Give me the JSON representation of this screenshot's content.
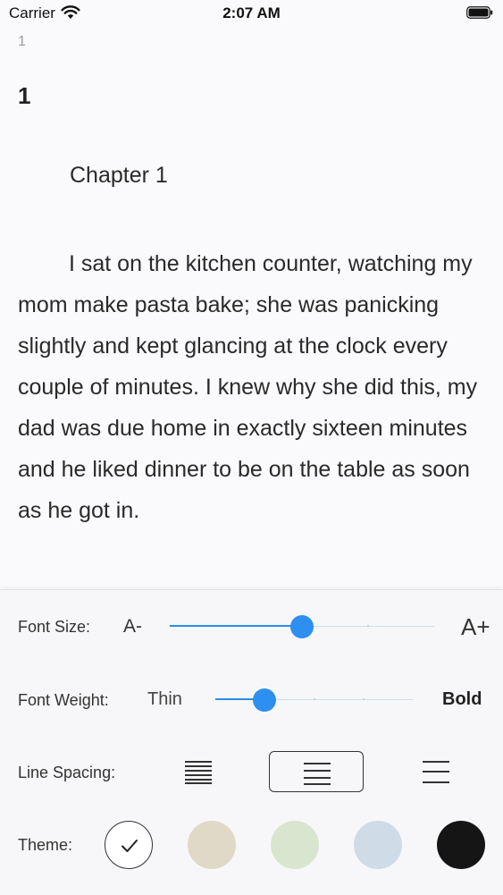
{
  "status_bar": {
    "carrier": "Carrier",
    "time": "2:07 AM"
  },
  "reader": {
    "page_number": "1",
    "chapter_number": "1",
    "chapter_title": "Chapter 1",
    "paragraph": "I sat on the kitchen counter, watching my mom make pasta bake; she was panicking slightly and kept glancing at the clock every couple of minutes. I knew why she did this, my dad was due home in exactly sixteen minutes and he liked dinner to be on the table as soon as he got in."
  },
  "settings": {
    "font_size": {
      "label": "Font Size:",
      "decrease_label": "A-",
      "increase_label": "A+",
      "level": 0.5,
      "steps": 5
    },
    "font_weight": {
      "label": "Font Weight:",
      "min_label": "Thin",
      "max_label": "Bold",
      "level": 0.25,
      "steps": 5
    },
    "line_spacing": {
      "label": "Line Spacing:",
      "options": [
        "compact",
        "normal",
        "wide"
      ],
      "selected": "normal"
    },
    "theme": {
      "label": "Theme:",
      "swatches": [
        {
          "name": "white",
          "color": "#ffffff",
          "selected": true
        },
        {
          "name": "sepia",
          "color": "#e0d9c7",
          "selected": false
        },
        {
          "name": "green",
          "color": "#d9e6cf",
          "selected": false
        },
        {
          "name": "blue",
          "color": "#cfdbe6",
          "selected": false
        },
        {
          "name": "black",
          "color": "#151515",
          "selected": false
        }
      ]
    }
  },
  "colors": {
    "accent": "#2d8ff0",
    "accent_track": "#c9dff5",
    "background": "#fafafc"
  }
}
